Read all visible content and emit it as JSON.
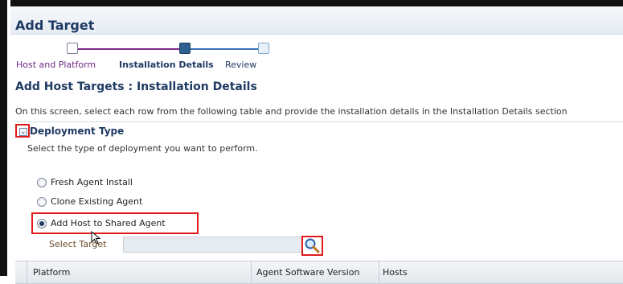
{
  "page": {
    "title": "Add Target"
  },
  "train": {
    "steps": [
      {
        "label": "Host and Platform",
        "state": "visited"
      },
      {
        "label": "Installation Details",
        "state": "current"
      },
      {
        "label": "Review",
        "state": "upcoming"
      }
    ]
  },
  "main": {
    "section_title": "Add Host Targets : Installation Details",
    "instruction": "On this screen, select each row from the following table and provide the installation details in the Installation Details section"
  },
  "deployment": {
    "title": "Deployment Type",
    "description": "Select the type of deployment you want to perform.",
    "options": [
      {
        "label": "Fresh Agent Install",
        "selected": false
      },
      {
        "label": "Clone Existing Agent",
        "selected": false
      },
      {
        "label": "Add Host to Shared Agent",
        "selected": true
      }
    ],
    "select_target_label": "Select Target",
    "select_target_value": ""
  },
  "table": {
    "columns": [
      "Platform",
      "Agent Software Version",
      "Hosts"
    ]
  },
  "icons": {
    "disclosure": "chevron-down-icon",
    "search": "search-icon",
    "cursor": "mouse-pointer-icon"
  },
  "colors": {
    "header_text": "#1f3b63",
    "visited_step": "#6b2a86",
    "highlight": "#e11b1b"
  }
}
